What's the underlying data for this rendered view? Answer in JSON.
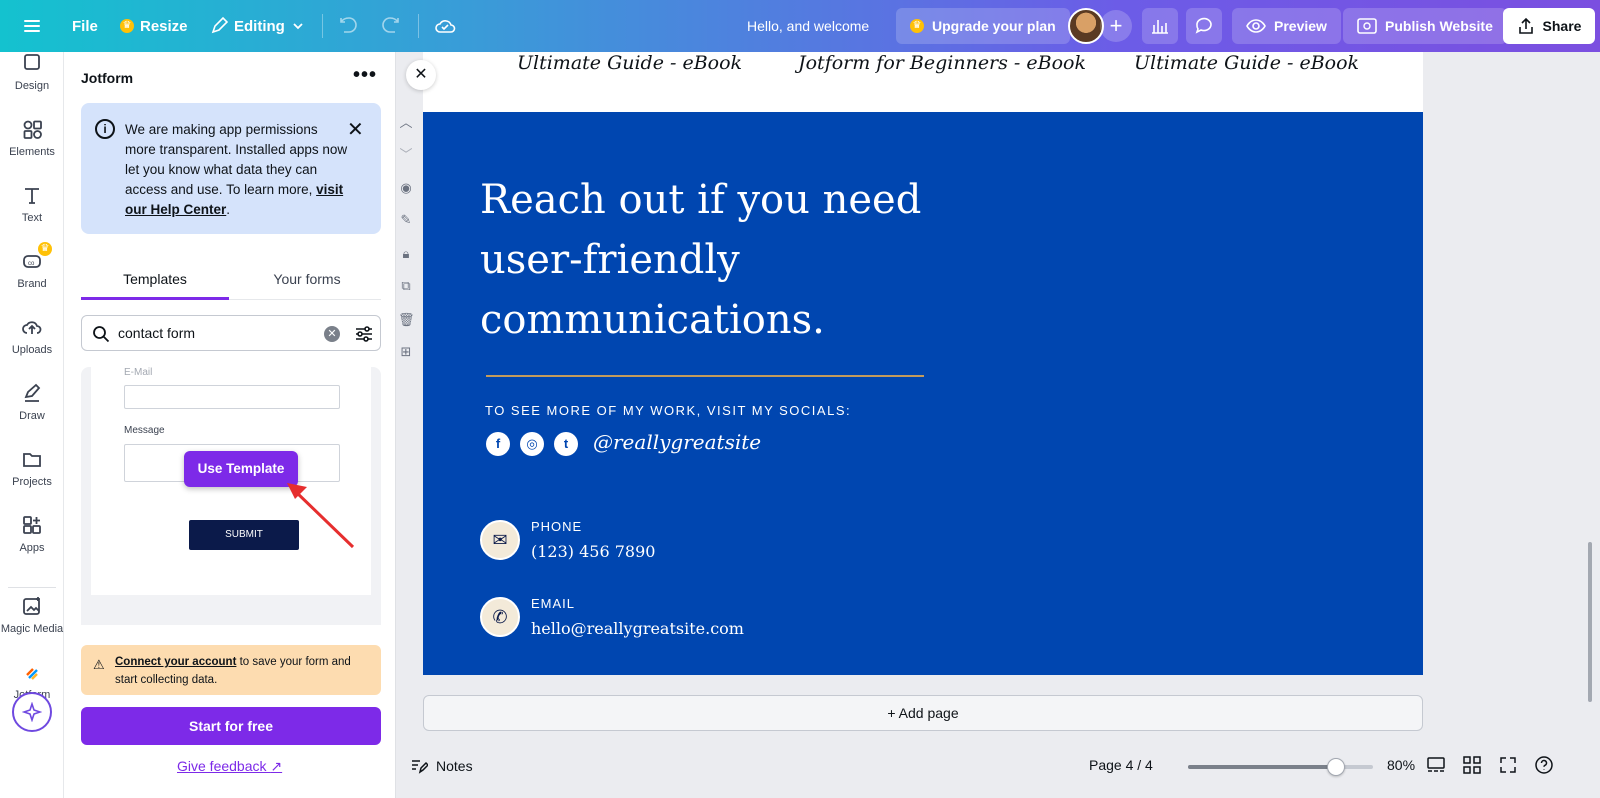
{
  "topbar": {
    "menu_icon": "hamburger-icon",
    "file_label": "File",
    "resize_label": "Resize",
    "editing_label": "Editing",
    "greeting": "Hello, and welcome",
    "upgrade_label": "Upgrade your plan",
    "preview_label": "Preview",
    "publish_label": "Publish Website",
    "share_label": "Share",
    "accent": "#7d2ae8"
  },
  "rail": {
    "items": [
      {
        "label": "Design",
        "icon": "design-icon"
      },
      {
        "label": "Elements",
        "icon": "elements-icon"
      },
      {
        "label": "Text",
        "icon": "text-icon"
      },
      {
        "label": "Brand",
        "icon": "brand-icon"
      },
      {
        "label": "Uploads",
        "icon": "uploads-icon"
      },
      {
        "label": "Draw",
        "icon": "draw-icon"
      },
      {
        "label": "Projects",
        "icon": "projects-icon"
      },
      {
        "label": "Apps",
        "icon": "apps-icon"
      },
      {
        "label": "Magic Media",
        "icon": "magic-media-icon"
      },
      {
        "label": "Jotform",
        "icon": "jotform-icon"
      }
    ]
  },
  "panel": {
    "title": "Jotform",
    "notice": {
      "text": "We are making app permissions more transparent. Installed apps now let you know what data they can access and use. To learn more,",
      "link": "visit our Help Center",
      "suffix": "."
    },
    "tabs": [
      "Templates",
      "Your forms"
    ],
    "search": {
      "value": "contact form"
    },
    "form_preview": {
      "email_label": "E-Mail",
      "message_label": "Message",
      "submit_label": "SUBMIT",
      "use_template_label": "Use Template"
    },
    "warning": {
      "link": "Connect your account",
      "text": " to save your form and start collecting data."
    },
    "start_label": "Start for free",
    "feedback_label": "Give feedback"
  },
  "canvas": {
    "ebooks": [
      "Ultimate Guide - eBook",
      "Jotform for Beginners - eBook",
      "Ultimate Guide - eBook"
    ],
    "headline": "Reach out if you need user-friendly communications.",
    "socials_label": "TO SEE MORE OF MY WORK, VISIT MY SOCIALS:",
    "social_icons": [
      "facebook-icon",
      "instagram-icon",
      "twitter-icon"
    ],
    "handle": "@reallygreatsite",
    "phone_label": "PHONE",
    "phone_value": "(123) 456 7890",
    "email_label": "EMAIL",
    "email_value": "hello@reallygreatsite.com",
    "add_page_label": "+ Add page",
    "page_bg": "#0046b0",
    "divider_color": "#c39b5c"
  },
  "bottombar": {
    "notes_label": "Notes",
    "page_indicator": "Page 4 / 4",
    "zoom_value": "80%",
    "zoom_fraction": 0.8
  }
}
